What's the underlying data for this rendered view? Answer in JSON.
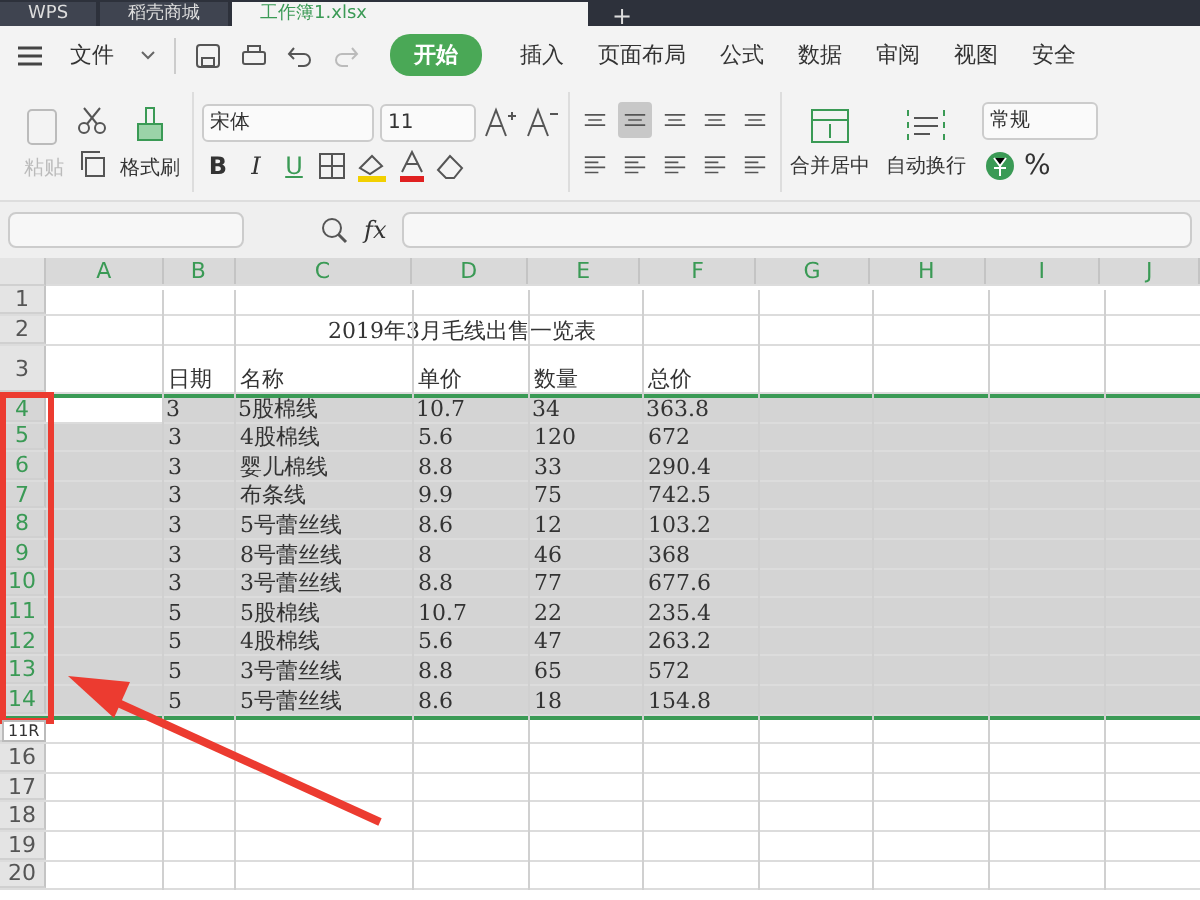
{
  "app_tabs": [
    {
      "label": "WPS",
      "selected": false
    },
    {
      "label": "稻壳商城",
      "selected": false
    },
    {
      "label": "工作簿1.xlsx",
      "selected": true
    }
  ],
  "new_tab": "+",
  "menu": {
    "file": "文件",
    "items": [
      {
        "label": "开始",
        "selected": true
      },
      {
        "label": "插入",
        "selected": false
      },
      {
        "label": "页面布局",
        "selected": false
      },
      {
        "label": "公式",
        "selected": false
      },
      {
        "label": "数据",
        "selected": false
      },
      {
        "label": "审阅",
        "selected": false
      },
      {
        "label": "视图",
        "selected": false
      },
      {
        "label": "安全",
        "selected": false
      }
    ]
  },
  "toolbar": {
    "paste": {
      "label": "粘贴",
      "disabled": true
    },
    "format_painter": "格式刷",
    "font": "宋体",
    "font_size": "11",
    "bold": "B",
    "italic": "I",
    "underline": "U",
    "merge": "合并居中",
    "wrap": "自动换行",
    "number_format": "常规",
    "percent": "%"
  },
  "formula_bar": {
    "fx": "fx"
  },
  "sheet": {
    "columns": [
      "A",
      "B",
      "C",
      "D",
      "E",
      "F",
      "G",
      "H",
      "I",
      "J"
    ],
    "rows": [
      {
        "header": "1",
        "kind": "empty",
        "selected": false
      },
      {
        "header": "2",
        "kind": "title",
        "selected": false,
        "text": "2019年3月毛线出售一览表"
      },
      {
        "header": "3",
        "kind": "data",
        "selected": false,
        "tall": true,
        "values": [
          "日期",
          "名称",
          "单价",
          "数量",
          "总价"
        ]
      },
      {
        "header": "4",
        "kind": "data",
        "selected": true,
        "active": true,
        "values": [
          "3",
          "5股棉线",
          "10.7",
          "34",
          "363.8"
        ]
      },
      {
        "header": "5",
        "kind": "data",
        "selected": true,
        "values": [
          "3",
          "4股棉线",
          "5.6",
          "120",
          "672"
        ]
      },
      {
        "header": "6",
        "kind": "data",
        "selected": true,
        "values": [
          "3",
          "婴儿棉线",
          "8.8",
          "33",
          "290.4"
        ]
      },
      {
        "header": "7",
        "kind": "data",
        "selected": true,
        "values": [
          "3",
          "布条线",
          "9.9",
          "75",
          "742.5"
        ]
      },
      {
        "header": "8",
        "kind": "data",
        "selected": true,
        "values": [
          "3",
          "5号蕾丝线",
          "8.6",
          "12",
          "103.2"
        ]
      },
      {
        "header": "9",
        "kind": "data",
        "selected": true,
        "values": [
          "3",
          "8号蕾丝线",
          "8",
          "46",
          "368"
        ]
      },
      {
        "header": "10",
        "kind": "data",
        "selected": true,
        "values": [
          "3",
          "3号蕾丝线",
          "8.8",
          "77",
          "677.6"
        ]
      },
      {
        "header": "11",
        "kind": "data",
        "selected": true,
        "values": [
          "5",
          "5股棉线",
          "10.7",
          "22",
          "235.4"
        ]
      },
      {
        "header": "12",
        "kind": "data",
        "selected": true,
        "values": [
          "5",
          "4股棉线",
          "5.6",
          "47",
          "263.2"
        ]
      },
      {
        "header": "13",
        "kind": "data",
        "selected": true,
        "values": [
          "5",
          "3号蕾丝线",
          "8.8",
          "65",
          "572"
        ]
      },
      {
        "header": "14",
        "kind": "data",
        "selected": true,
        "values": [
          "5",
          "5号蕾丝线",
          "8.6",
          "18",
          "154.8"
        ]
      },
      {
        "tip": "11R",
        "kind": "empty",
        "selected": false
      },
      {
        "header": "16",
        "kind": "empty",
        "selected": false
      },
      {
        "header": "17",
        "kind": "empty",
        "selected": false
      },
      {
        "header": "18",
        "kind": "empty",
        "selected": false
      },
      {
        "header": "19",
        "kind": "empty",
        "selected": false
      },
      {
        "header": "20",
        "kind": "empty",
        "selected": false
      }
    ]
  }
}
